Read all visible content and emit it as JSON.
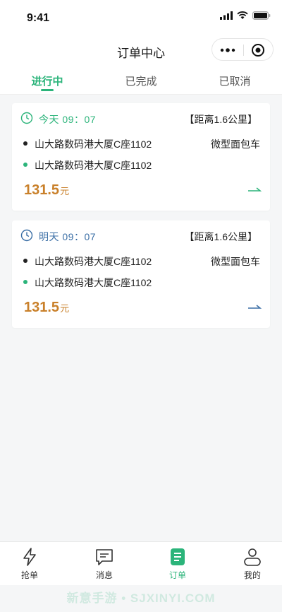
{
  "status_bar": {
    "time": "9:41"
  },
  "nav": {
    "title": "订单中心"
  },
  "tabs": [
    {
      "label": "进行中",
      "active": true
    },
    {
      "label": "已完成",
      "active": false
    },
    {
      "label": "已取消",
      "active": false
    }
  ],
  "orders": [
    {
      "time_label": "今天 09：07",
      "time_color": "#2bb47a",
      "distance": "【距离1.6公里】",
      "from": "山大路数码港大厦C座1102",
      "to": "山大路数码港大厦C座1102",
      "vehicle": "微型面包车",
      "price": "131.5",
      "currency": "元",
      "arrow_color": "#2bb47a"
    },
    {
      "time_label": "明天 09：07",
      "time_color": "#3a6ea5",
      "distance": "【距离1.6公里】",
      "from": "山大路数码港大厦C座1102",
      "to": "山大路数码港大厦C座1102",
      "vehicle": "微型面包车",
      "price": "131.5",
      "currency": "元",
      "arrow_color": "#3a6ea5"
    }
  ],
  "tabbar": [
    {
      "label": "抢单",
      "icon": "lightning-icon",
      "active": false
    },
    {
      "label": "消息",
      "icon": "message-icon",
      "active": false
    },
    {
      "label": "订单",
      "icon": "order-icon",
      "active": true
    },
    {
      "label": "我的",
      "icon": "profile-icon",
      "active": false
    }
  ],
  "watermark": "新意手游 • SJXINYI.COM",
  "colors": {
    "accent": "#2bb47a",
    "price": "#c9802a",
    "tomorrow": "#3a6ea5"
  }
}
